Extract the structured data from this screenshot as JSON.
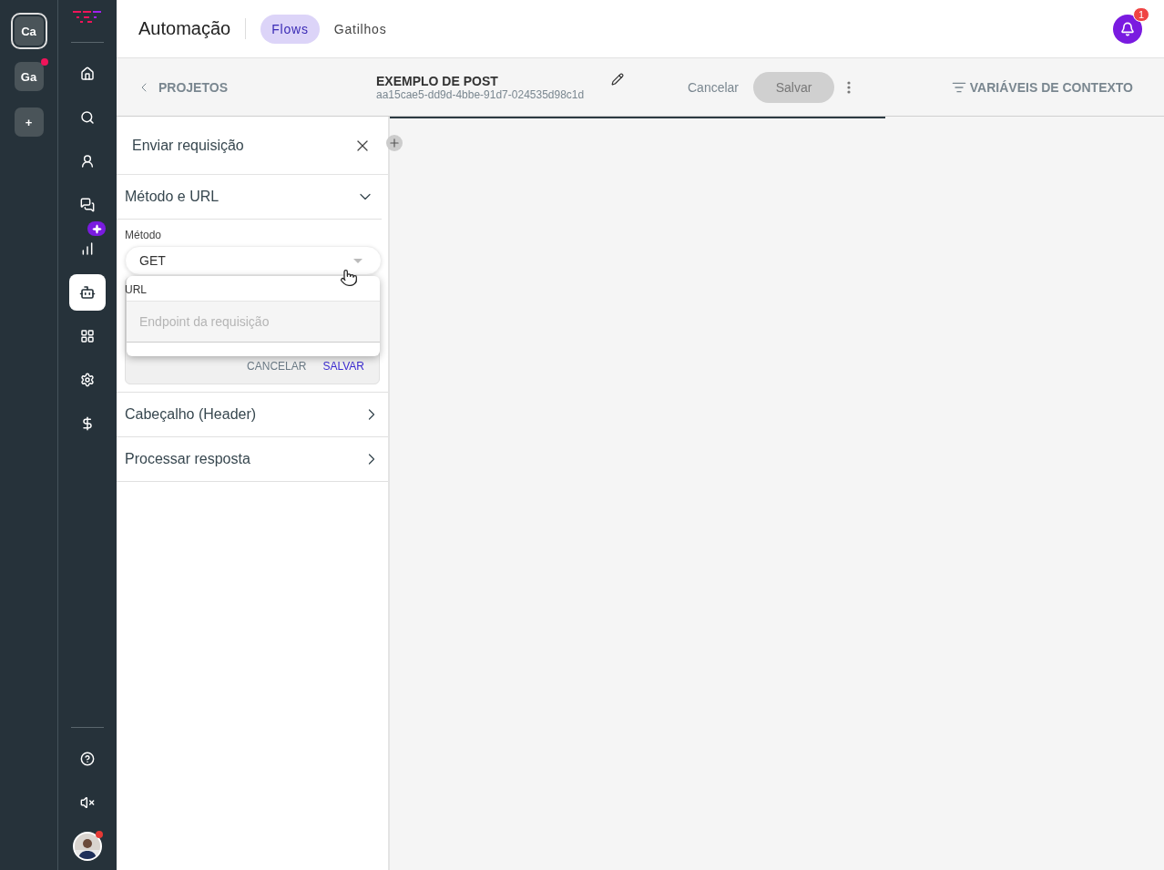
{
  "workspaces": [
    {
      "label": "Ca",
      "selected": true,
      "unread": false
    },
    {
      "label": "Ga",
      "selected": false,
      "unread": true
    }
  ],
  "add_workspace": "+",
  "nav": [
    {
      "kind": "home",
      "selected": false,
      "new": false
    },
    {
      "kind": "search",
      "selected": false,
      "new": false
    },
    {
      "kind": "person",
      "selected": false,
      "new": false
    },
    {
      "kind": "chat",
      "selected": false,
      "new": false
    },
    {
      "kind": "chart",
      "selected": false,
      "new": true
    },
    {
      "kind": "bot",
      "selected": true,
      "new": false
    },
    {
      "kind": "apps",
      "selected": false,
      "new": false
    },
    {
      "kind": "settings",
      "selected": false,
      "new": false
    },
    {
      "kind": "dollar",
      "selected": false,
      "new": false
    }
  ],
  "nav_bottom": [
    {
      "kind": "help"
    },
    {
      "kind": "mute"
    }
  ],
  "user": {
    "unread": true
  },
  "header": {
    "title": "Automação",
    "tabs": [
      {
        "label": "Flows",
        "selected": true
      },
      {
        "label": "Gatilhos",
        "selected": false
      }
    ],
    "notifications": "1"
  },
  "toolbar": {
    "back": "PROJETOS",
    "flow_name": "EXEMPLO DE POST",
    "flow_id": "aa15cae5-dd9d-4bbe-91d7-024535d98c1d",
    "cancel": "Cancelar",
    "save": "Salvar",
    "save_disabled": true,
    "context": "VARIÁVEIS DE CONTEXTO"
  },
  "panel": {
    "title": "Enviar requisição",
    "sections": [
      {
        "title": "Método e URL",
        "expanded": true
      },
      {
        "title": "Cabeçalho (Header)",
        "expanded": false
      },
      {
        "title": "Processar resposta",
        "expanded": false
      }
    ],
    "method_label": "Método",
    "method": "GET",
    "url_label": "URL",
    "url_placeholder": "Endpoint da requisição",
    "cancel": "CANCELAR",
    "save": "SALVAR"
  }
}
